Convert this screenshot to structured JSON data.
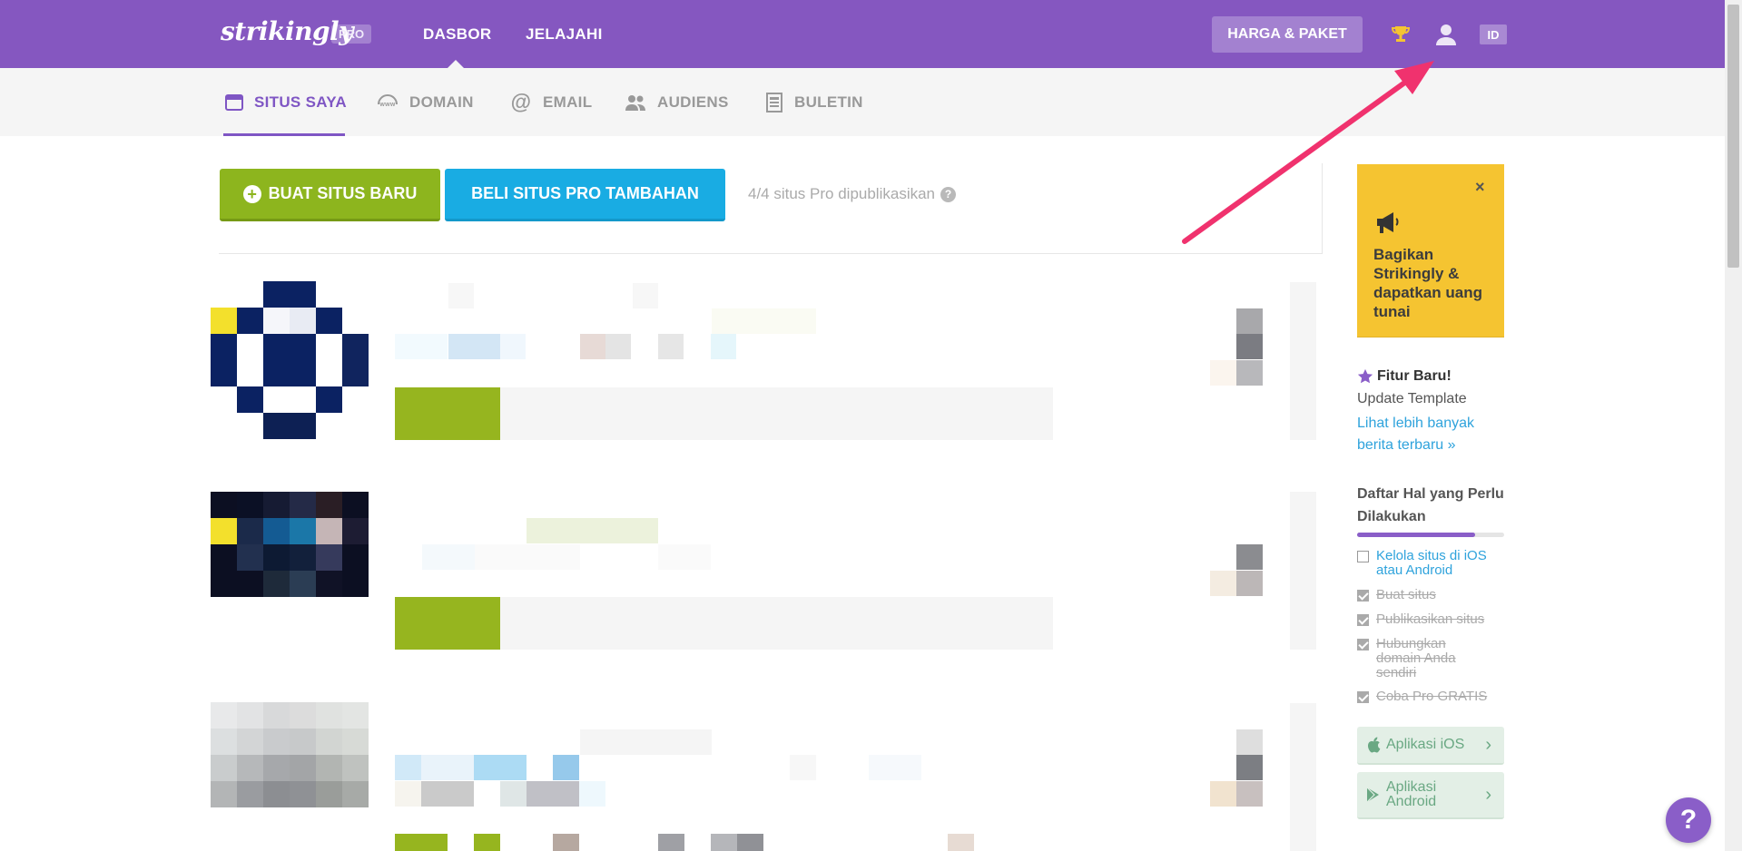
{
  "colors": {
    "brand_purple": "#8557c0",
    "green": "#8db51e",
    "blue": "#19ace3",
    "promo_yellow": "#f5c431",
    "annotation_arrow": "#f0326e"
  },
  "topbar": {
    "logo": "strikingly",
    "pro_badge": "PRO",
    "nav": [
      {
        "label": "DASBOR",
        "active": true
      },
      {
        "label": "JELAJAHI"
      }
    ],
    "pricing_label": "HARGA & PAKET",
    "lang": "ID",
    "icons": [
      "trophy-icon",
      "user-icon"
    ]
  },
  "subnav": {
    "tabs": [
      {
        "label": "SITUS SAYA",
        "icon": "browser-window-icon",
        "active": true
      },
      {
        "label": "DOMAIN",
        "icon": "www-globe-icon"
      },
      {
        "label": "EMAIL",
        "icon": "at-sign-icon"
      },
      {
        "label": "AUDIENS",
        "icon": "people-icon"
      },
      {
        "label": "BULETIN",
        "icon": "newsletter-icon"
      }
    ]
  },
  "actions": {
    "create_label": "BUAT SITUS BARU",
    "buy_label": "BELI SITUS PRO TAMBAHAN",
    "pub_status": "4/4 situs Pro dipublikasikan",
    "help_glyph": "?"
  },
  "sidebar": {
    "promo": {
      "close": "×",
      "text": "Bagikan Strikingly & dapatkan uang tunai"
    },
    "feature": {
      "title": "Fitur Baru!",
      "subtitle": "Update Template",
      "link": "Lihat lebih banyak berita terbaru »"
    },
    "todo": {
      "title": "Daftar Hal yang Perlu Dilakukan",
      "progress": 0.8,
      "items": [
        {
          "label": "Kelola situs di iOS atau Android",
          "done": false
        },
        {
          "label": "Buat situs",
          "done": true
        },
        {
          "label": "Publikasikan situs",
          "done": true
        },
        {
          "label": "Hubungkan domain Anda sendiri",
          "done": true
        },
        {
          "label": "Coba Pro GRATIS",
          "done": true
        }
      ]
    },
    "apps": {
      "ios_label": "Aplikasi iOS",
      "android_label": "Aplikasi Android"
    }
  },
  "help_fab": "?"
}
